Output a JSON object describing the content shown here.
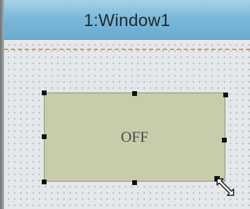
{
  "window": {
    "title": "1:Window1"
  },
  "control": {
    "label": "OFF",
    "fill_color": "#c8ccaa"
  },
  "colors": {
    "title_bar": "#7cb9d9",
    "canvas": "#e4e8ea",
    "guide_line": "#b89a6e"
  },
  "cursor": {
    "icon": "diagonal-resize-arrow-icon"
  }
}
